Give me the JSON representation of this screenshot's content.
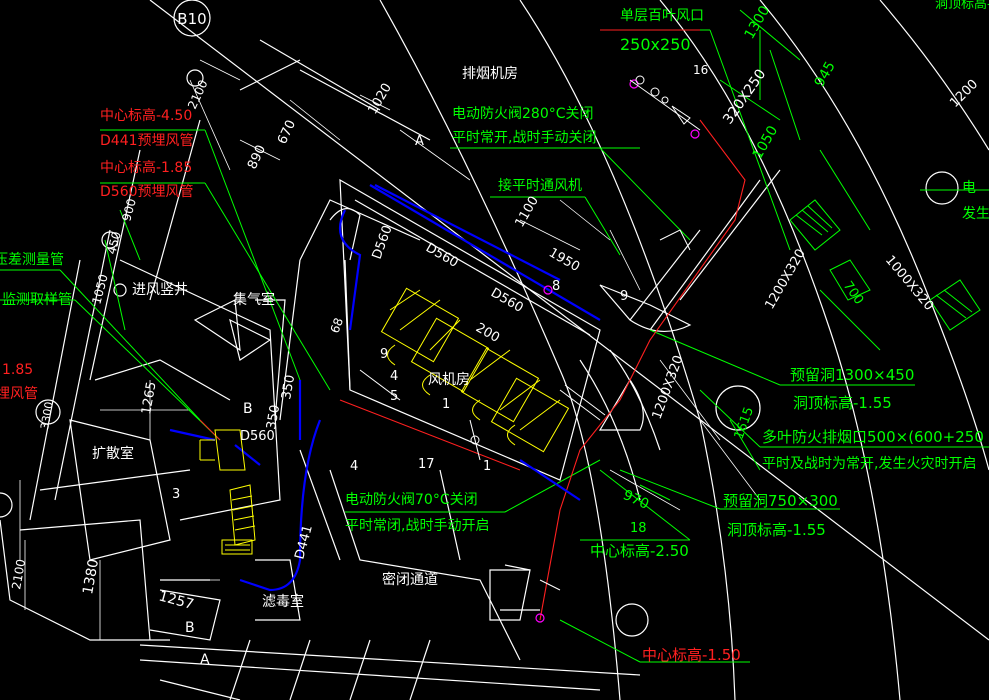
{
  "colors": {
    "background": "#000000",
    "wall": "#ffffff",
    "annotation": "#00ff00",
    "warning": "#ff2020",
    "duct": "#0000ff",
    "equipment": "#ffff00",
    "magenta": "#ff00ff"
  },
  "labels": {
    "b10": "B10",
    "smoke_exhaust_room": "排烟机房",
    "single_louver": "单层百叶风口",
    "single_louver_size": "250x250",
    "tag16": "16",
    "size_320x250": "320X250",
    "dim_1300": "1300",
    "dim_945": "945",
    "dim_1050": "1050",
    "dim_1200_top": "1200",
    "top_right_elev": "洞顶标高-",
    "valve_280": "电动防火阀280°C关闭",
    "valve_280_note": "平时常开,战时手动关闭",
    "connect_fan": "接平时通风机",
    "dim_1020": "1020",
    "dim_2100": "2100",
    "dim_890": "890",
    "dim_670": "670",
    "axis_a_top": "A",
    "red_center_450": "中心标高-4.50",
    "red_d441": "D441预埋风管",
    "red_center_185": "中心标高-1.85",
    "red_d560": "D560预埋风管",
    "pressure_tube": "压差测量管",
    "sampling_tube": "监测取样管",
    "red_185_left": "1.85",
    "red_pipe_left": "埋风管",
    "dim_900": "900",
    "dim_450": "450",
    "dim_1050_left": "1050",
    "shaft": "进风竖井",
    "air_collect": "集气室",
    "d560_a": "D560",
    "d560_b": "D560",
    "d560_c": "D560",
    "d560_d": "D560",
    "d441": "D441",
    "dim_1100": "1100",
    "dim_1950": "1950",
    "dim_200": "200",
    "tag8": "8",
    "tag9a": "9",
    "tag9b": "9",
    "tag4a": "4",
    "tag4b": "4",
    "tag5": "5",
    "tag1a": "1",
    "tag1b": "1",
    "tag17": "17",
    "tag3": "3",
    "tag18": "18",
    "dim_68": "68",
    "fan_room": "风机房",
    "dim_1265": "1265",
    "dim_350a": "350",
    "dim_350b": "350",
    "axis_b_mid": "B",
    "axis_b_bottom": "B",
    "axis_a_bottom": "A",
    "expand_room": "扩散室",
    "dim_3300": "3300",
    "size_1200x320_a": "1200X320",
    "size_1200x320_b": "1200X320",
    "size_1000x320": "1000X320",
    "dim_700": "700",
    "reserved_hole_1": "预留洞1300×450",
    "hole_elev_1": "洞顶标高-1.55",
    "dim_1615": "1615",
    "multi_louver": "多叶防火排烟口500×(600+250",
    "multi_louver_note": "平时及战时为常开,发生火灾时开启",
    "right_elev_fire": "电",
    "right_fire_2": "发生",
    "dim_970": "970",
    "reserved_hole_2": "预留洞750×300",
    "hole_elev_2": "洞顶标高-1.55",
    "valve_70": "电动防火阀70°C关闭",
    "valve_70_note": "平时常闭,战时手动开启",
    "center_250": "中心标高-2.50",
    "dim_2100_left": "2100",
    "dim_1380": "1380",
    "dim_1257": "1257",
    "filter_room": "滤毒室",
    "airlock": "密闭通道",
    "center_150": "中心标高-1.50"
  }
}
